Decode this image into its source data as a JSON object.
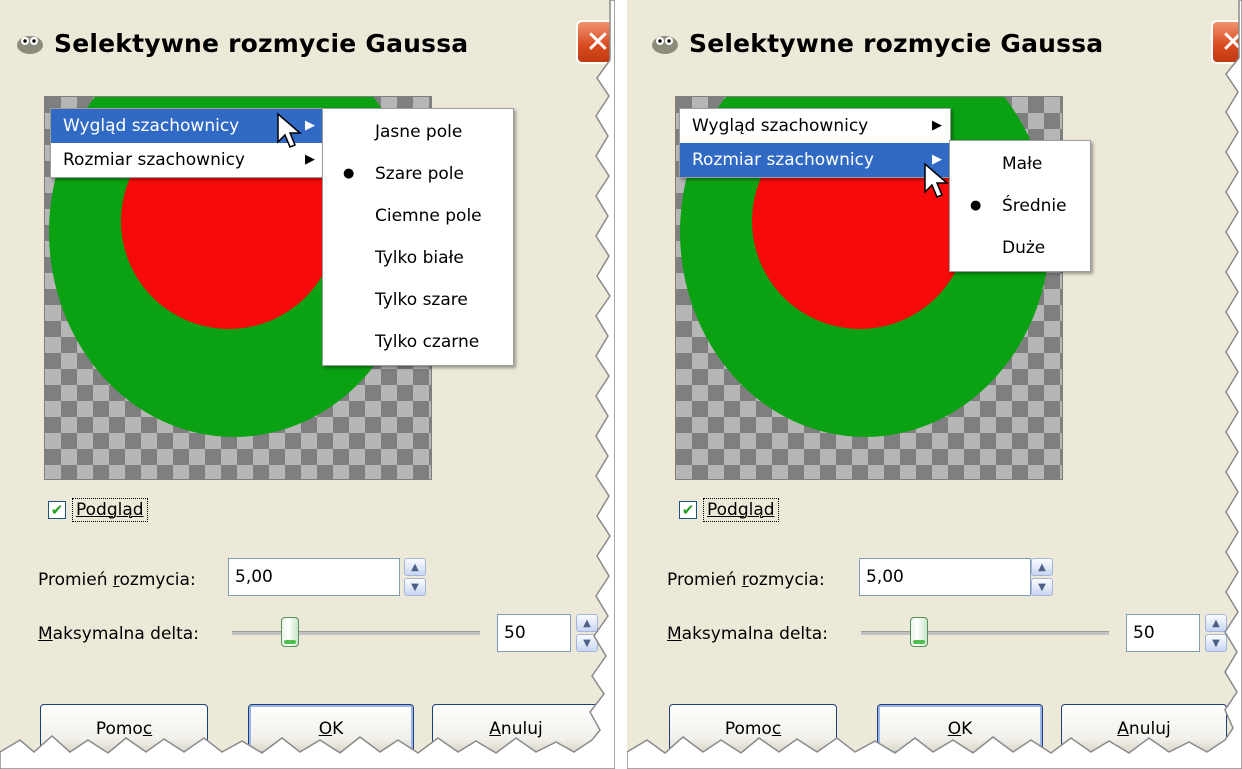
{
  "dialog": {
    "title": "Selektywne rozmycie Gaussa",
    "close_glyph": "✕"
  },
  "menu": {
    "items": [
      {
        "label": "Wygląd szachownicy",
        "arrow": "▶"
      },
      {
        "label": "Rozmiar szachownicy",
        "arrow": "▶"
      }
    ]
  },
  "left_submenu": {
    "items": [
      {
        "label": "Jasne pole",
        "selected": false
      },
      {
        "label": "Szare pole",
        "selected": true
      },
      {
        "label": "Ciemne pole",
        "selected": false
      },
      {
        "label": "Tylko białe",
        "selected": false
      },
      {
        "label": "Tylko szare",
        "selected": false
      },
      {
        "label": "Tylko czarne",
        "selected": false
      }
    ],
    "bullet": "●"
  },
  "right_submenu": {
    "items": [
      {
        "label": "Małe",
        "selected": false
      },
      {
        "label": "Średnie",
        "selected": true
      },
      {
        "label": "Duże",
        "selected": false
      }
    ],
    "bullet": "●"
  },
  "preview_checkbox": {
    "label": "Podgląd",
    "checked": true,
    "check_glyph": "✔"
  },
  "radius": {
    "label_pre": "Promień ",
    "label_u": "r",
    "label_post": "ozmycia:",
    "value": "5,00"
  },
  "max_delta": {
    "label_u": "M",
    "label_post": "aksymalna delta:",
    "value": "50",
    "slider_fraction": 0.235
  },
  "buttons": {
    "help_pre": "Pomo",
    "help_u": "c",
    "ok_u": "O",
    "ok_post": "K",
    "cancel_u": "A",
    "cancel_post": "nuluj"
  },
  "spin_glyphs": {
    "up": "▲",
    "down": "▼"
  },
  "colors": {
    "dialog_bg": "#ece9d8",
    "menu_highlight": "#316ac5",
    "ring": "#0aa112",
    "disc": "#f70a0a"
  }
}
